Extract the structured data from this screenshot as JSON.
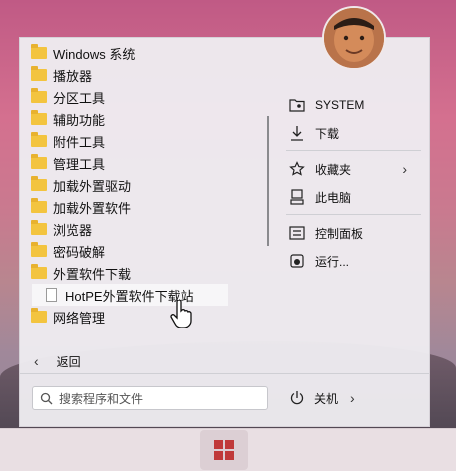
{
  "user": {
    "avatar_icon": "user-avatar"
  },
  "programs": [
    {
      "label": "Windows 系统",
      "icon": "folder-icon"
    },
    {
      "label": "播放器",
      "icon": "folder-icon"
    },
    {
      "label": "分区工具",
      "icon": "folder-icon"
    },
    {
      "label": "辅助功能",
      "icon": "folder-icon"
    },
    {
      "label": "附件工具",
      "icon": "folder-icon"
    },
    {
      "label": "管理工具",
      "icon": "folder-icon"
    },
    {
      "label": "加载外置驱动",
      "icon": "folder-icon"
    },
    {
      "label": "加载外置软件",
      "icon": "folder-icon"
    },
    {
      "label": "浏览器",
      "icon": "folder-icon"
    },
    {
      "label": "密码破解",
      "icon": "folder-icon"
    },
    {
      "label": "外置软件下载",
      "icon": "folder-icon"
    },
    {
      "label": "HotPE外置软件下载站",
      "icon": "file-icon"
    },
    {
      "label": "网络管理",
      "icon": "folder-icon"
    }
  ],
  "places": {
    "system": "SYSTEM",
    "downloads": "下载",
    "favorites": "收藏夹",
    "this_pc": "此电脑",
    "control_panel": "控制面板",
    "run": "运行..."
  },
  "footer": {
    "back_label": "返回",
    "search_placeholder": "搜索程序和文件",
    "power_label": "关机"
  },
  "colors": {
    "folder": "#f3c43f",
    "start_logo": "#c03a3a"
  }
}
